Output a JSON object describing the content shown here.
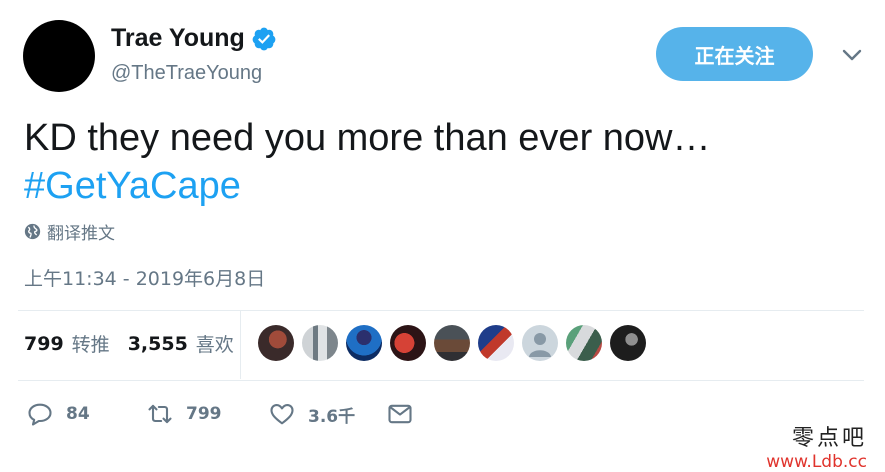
{
  "author": {
    "name": "Trae Young",
    "handle": "@TheTraeYoung",
    "verified": true
  },
  "follow_button": {
    "label": "正在关注"
  },
  "tweet": {
    "text": "KD they need you more than ever now…",
    "hashtag": "#GetYaCape"
  },
  "translate_label": "翻译推文",
  "timestamp": "上午11:34 - 2019年6月8日",
  "stats": {
    "retweets_count": "799",
    "retweets_label": "转推",
    "likes_count": "3,555",
    "likes_label": "喜欢"
  },
  "actions": {
    "reply_count": "84",
    "retweet_count": "799",
    "like_count": "3.6千"
  },
  "watermark": {
    "line1": "零点吧",
    "line2": "www.Ldb.cc"
  },
  "colors": {
    "accent": "#1da1f2",
    "follow_button": "#56b3ea",
    "secondary_text": "#657786",
    "divider": "#e6ecf0"
  },
  "icons": [
    "verified-badge-icon",
    "chevron-down-icon",
    "globe-icon",
    "reply-icon",
    "retweet-icon",
    "heart-icon",
    "envelope-icon"
  ]
}
